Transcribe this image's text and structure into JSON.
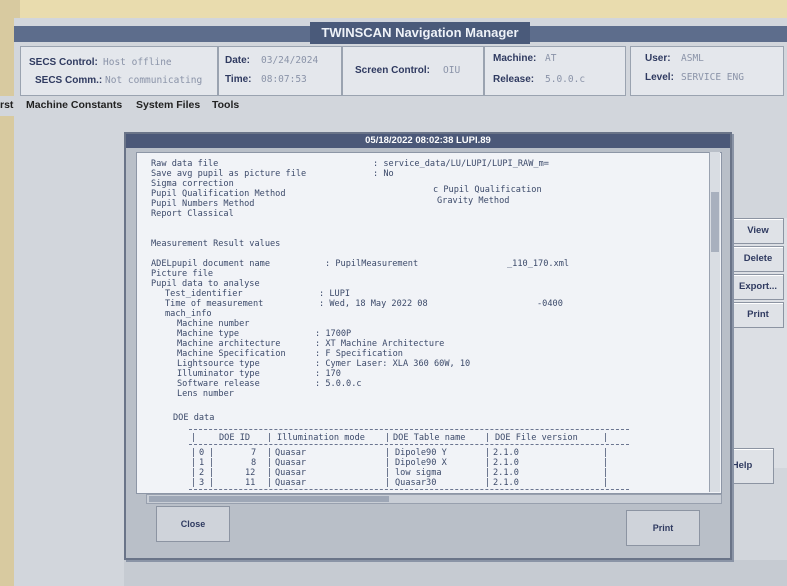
{
  "window": {
    "title": "TWINSCAN Navigation Manager"
  },
  "header": {
    "secs_control_label": "SECS Control:",
    "secs_control_value": "Host offline",
    "secs_comm_label": "SECS Comm.:",
    "secs_comm_value": "Not communicating",
    "date_label": "Date:",
    "date_value": "03/24/2024",
    "time_label": "Time:",
    "time_value": "08:07:53",
    "screen_control_label": "Screen Control:",
    "screen_control_value": "OIU",
    "machine_label": "Machine:",
    "machine_value": "AT",
    "release_label": "Release:",
    "release_value": "5.0.0.c",
    "user_label": "User:",
    "user_value": "ASML",
    "level_label": "Level:",
    "level_value": "SERVICE ENG"
  },
  "menu": {
    "item0": "rst",
    "item1": "Machine Constants",
    "item2": "System Files",
    "item3": "Tools"
  },
  "dialog": {
    "title": "05/18/2022 08:02:38 LUPI.89",
    "lines": {
      "raw_data_file": "Raw data file",
      "raw_data_file_val": ": service_data/LU/LUPI/LUPI_RAW_m=",
      "save_avg": "Save avg pupil as picture file",
      "save_avg_val": ": No",
      "sigma": "Sigma correction",
      "pupil_qual": "Pupil Qualification Method",
      "pupil_qual_val": "c Pupil Qualification",
      "pupil_num": "Pupil Numbers Method",
      "pupil_num_val": "Gravity Method",
      "report": "Report Classical",
      "mrv": "Measurement Result values",
      "adel": "ADELpupil document name",
      "adel_val": ": PupilMeasurement",
      "adel_val2": "_110_170.xml",
      "picture": "Picture file",
      "pdata": "Pupil data to analyse",
      "test_id": "Test_identifier",
      "test_id_val": ": LUPI",
      "tom": "Time of measurement",
      "tom_val": ": Wed, 18 May 2022 08",
      "tom_val2": "-0400",
      "mach_info": "mach_info",
      "mnum": "Machine number",
      "mtype": "Machine type",
      "mtype_val": ": 1700P",
      "march": "Machine architecture",
      "march_val": ": XT Machine Architecture",
      "mspec": "Machine Specification",
      "mspec_val": ": F Specification",
      "ls": "Lightsource type",
      "ls_val": ": Cymer Laser: XLA 360 60W, 10",
      "ill": "Illuminator type",
      "ill_val": ": 170",
      "sw": "Software release",
      "sw_val": ": 5.0.0.c",
      "lens": "Lens number",
      "doe": "DOE data"
    },
    "doe_table": {
      "headers": [
        "DOE ID",
        "Illumination mode",
        "DOE Table name",
        "DOE File version"
      ],
      "rows": [
        [
          "0",
          "7",
          "Quasar",
          "Dipole90 Y",
          "2.1.0"
        ],
        [
          "1",
          "8",
          "Quasar",
          "Dipole90 X",
          "2.1.0"
        ],
        [
          "2",
          "12",
          "Quasar",
          "low sigma",
          "2.1.0"
        ],
        [
          "3",
          "11",
          "Quasar",
          "Quasar30",
          "2.1.0"
        ]
      ]
    },
    "close_label": "Close",
    "print_label": "Print"
  },
  "side_buttons": {
    "view": "View",
    "delete": "Delete",
    "export": "Export...",
    "print": "Print",
    "help": "Help"
  }
}
